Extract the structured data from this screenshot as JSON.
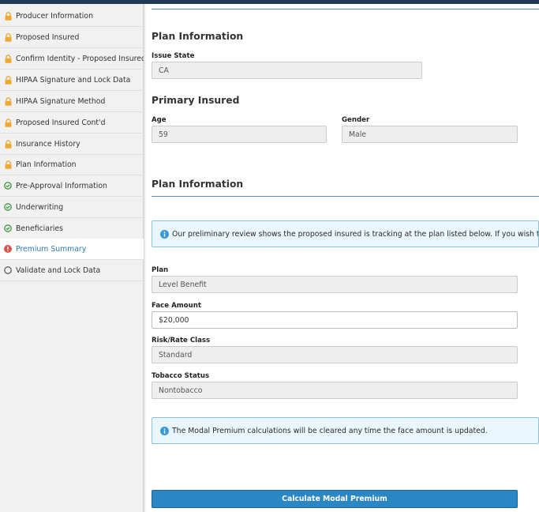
{
  "colors": {
    "accent": "#2a79b9",
    "lock": "#f0a830",
    "complete": "#3c9a3c",
    "error": "#d9534f",
    "info_bg": "#e9f6fb",
    "button": "#2b87c4"
  },
  "sidebar": {
    "items": [
      {
        "label": "Producer Information",
        "status": "locked",
        "icon": "lock-icon"
      },
      {
        "label": "Proposed Insured",
        "status": "locked",
        "icon": "lock-icon"
      },
      {
        "label": "Confirm Identity - Proposed Insured",
        "status": "locked",
        "icon": "lock-icon"
      },
      {
        "label": "HIPAA Signature and Lock Data",
        "status": "locked",
        "icon": "lock-icon"
      },
      {
        "label": "HIPAA Signature Method",
        "status": "locked",
        "icon": "lock-icon"
      },
      {
        "label": "Proposed Insured Cont'd",
        "status": "locked",
        "icon": "lock-icon"
      },
      {
        "label": "Insurance History",
        "status": "locked",
        "icon": "lock-icon"
      },
      {
        "label": "Plan Information",
        "status": "locked",
        "icon": "lock-icon"
      },
      {
        "label": "Pre-Approval Information",
        "status": "complete",
        "icon": "check-circle-icon"
      },
      {
        "label": "Underwriting",
        "status": "complete",
        "icon": "check-circle-icon"
      },
      {
        "label": "Beneficiaries",
        "status": "complete",
        "icon": "check-circle-icon"
      },
      {
        "label": "Premium Summary",
        "status": "error",
        "icon": "exclamation-circle-icon"
      },
      {
        "label": "Validate and Lock Data",
        "status": "pending",
        "icon": "empty-circle-icon"
      }
    ]
  },
  "main": {
    "plan_info_heading": "Plan Information",
    "issue_state": {
      "label": "Issue State",
      "value": "CA"
    },
    "primary_insured_heading": "Primary Insured",
    "age": {
      "label": "Age",
      "value": "59"
    },
    "gender": {
      "label": "Gender",
      "value": "Male"
    },
    "plan_info_heading_2": "Plan Information",
    "review_notice": "Our preliminary review shows the proposed insured is tracking at the plan listed below. If you wish to adjust the",
    "plan": {
      "label": "Plan",
      "value": "Level Benefit"
    },
    "face_amount": {
      "label": "Face Amount",
      "value": "$20,000"
    },
    "risk_rate_class": {
      "label": "Risk/Rate Class",
      "value": "Standard"
    },
    "tobacco_status": {
      "label": "Tobacco Status",
      "value": "Nontobacco"
    },
    "modal_notice": "The Modal Premium calculations will be cleared any time the face amount is updated.",
    "calculate_button": "Calculate Modal Premium"
  }
}
